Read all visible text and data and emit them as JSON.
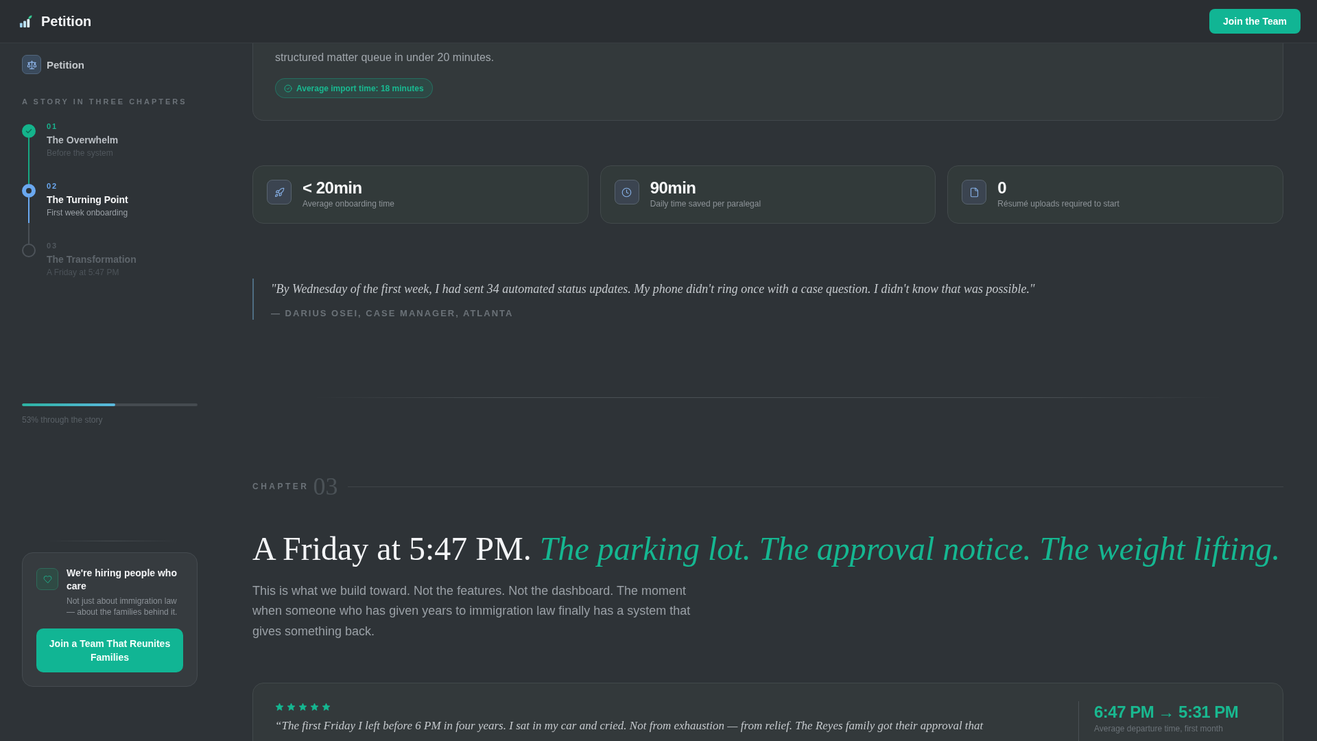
{
  "header": {
    "brand": "Petition",
    "button": "Join the Team"
  },
  "sidebar": {
    "brand": "Petition",
    "section_title": "A STORY IN THREE CHAPTERS",
    "chapters": [
      {
        "number": "01",
        "title": "The Overwhelm",
        "subtitle": "Before the system",
        "completed": true,
        "selected": false
      },
      {
        "number": "02",
        "title": "The Turning Point",
        "subtitle": "First week onboarding",
        "completed": false,
        "selected": true
      },
      {
        "number": "03",
        "title": "The Transformation",
        "subtitle": "A Friday at 5:47 PM",
        "completed": false,
        "selected": false
      }
    ],
    "progress": {
      "level": 0.53,
      "label": "53% through the story"
    },
    "hiring_card": {
      "title": "We're hiring people who care",
      "text": "Not just about immigration law — about the families behind it.",
      "button": "Join a Team That Reunites Families"
    }
  },
  "main": {
    "import_card": {
      "text": "structured matter queue in under 20 minutes.",
      "badge": "Average import time: 18 minutes"
    },
    "stats": [
      {
        "value": "< 20min",
        "label": "Average onboarding time"
      },
      {
        "value": "90min",
        "label": "Daily time saved per paralegal"
      },
      {
        "value": "0",
        "label": "Résumé uploads required to start"
      }
    ],
    "quote": {
      "text": "\"By Wednesday of the first week, I had sent 34 automated status updates. My phone didn't ring once with a case question. I didn't know that was possible.\"",
      "author": "— DARIUS OSEI, CASE MANAGER, ATLANTA"
    },
    "chapter": {
      "label": "CHAPTER",
      "number": "03",
      "heading": "A Friday at 5:47 PM. *The parking lot. The approval notice. The weight lifting.*",
      "text": "This is what we build toward. Not the features. Not the dashboard. The moment when someone who has given years to immigration law finally has a system that gives something back."
    },
    "testimonial": {
      "stars": 5,
      "quote": "“The first Friday I left before 6 PM in four years. I sat in my car and cried. Not from exhaustion — from relief. The Reyes family got their approval that",
      "metric": "6:47 PM → 5:31 PM",
      "metric_label": "Average departure time, first month"
    }
  }
}
